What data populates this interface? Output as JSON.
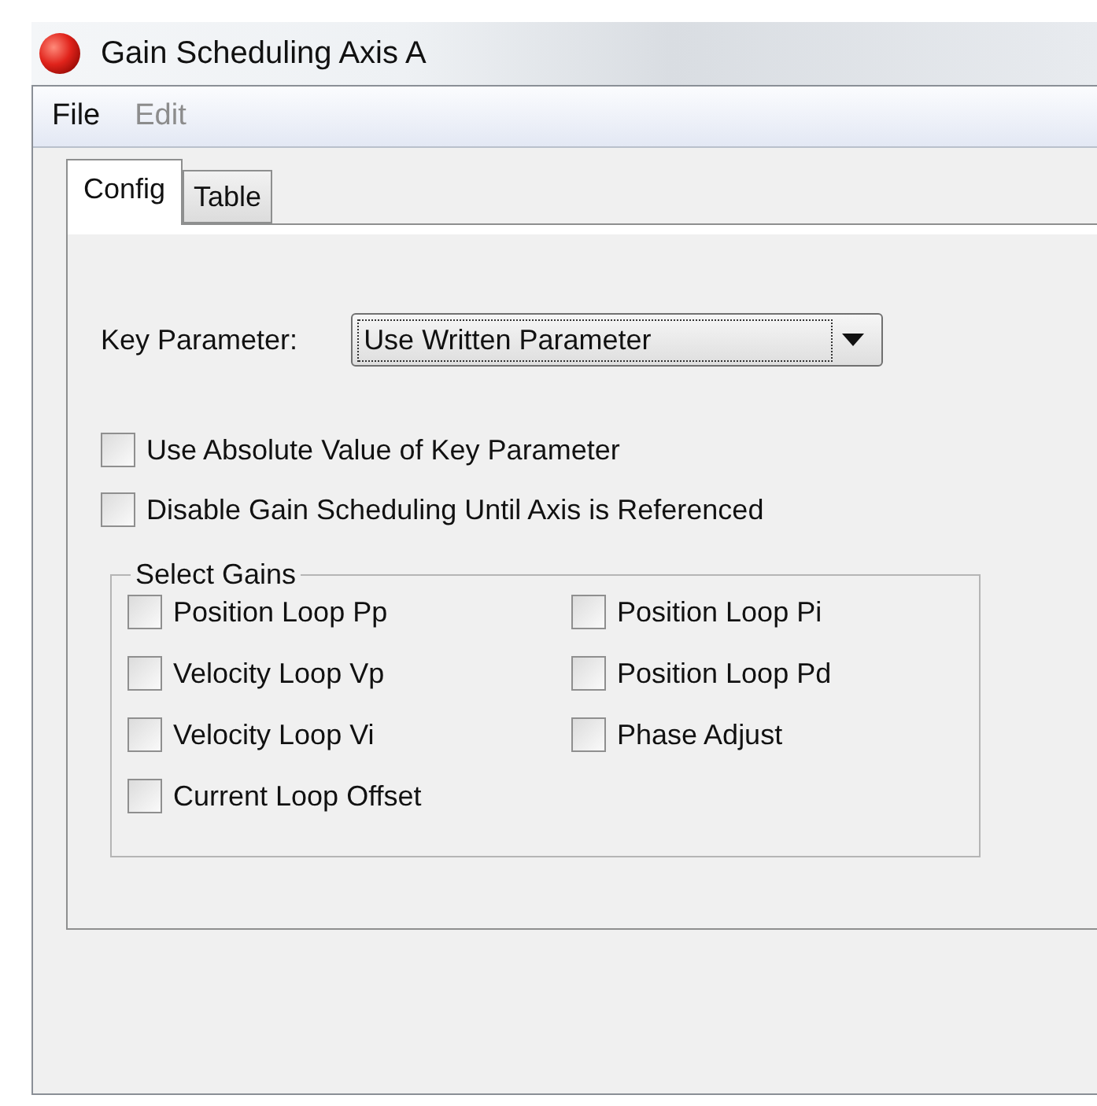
{
  "window": {
    "title": "Gain Scheduling Axis A"
  },
  "menu": [
    {
      "label": "File",
      "disabled": false
    },
    {
      "label": "Edit",
      "disabled": true
    }
  ],
  "tabs": [
    {
      "label": "Config",
      "selected": true
    },
    {
      "label": "Table",
      "selected": false
    }
  ],
  "key_parameter": {
    "label": "Key Parameter:",
    "value": "Use Written Parameter"
  },
  "options": [
    {
      "label": "Use Absolute Value of Key Parameter",
      "checked": false
    },
    {
      "label": "Disable Gain Scheduling Until Axis is Referenced",
      "checked": false
    }
  ],
  "select_gains": {
    "title": "Select Gains",
    "items": [
      {
        "label": "Position Loop Pp",
        "checked": false
      },
      {
        "label": "Position Loop Pi",
        "checked": false
      },
      {
        "label": "Velocity Loop Vp",
        "checked": false
      },
      {
        "label": "Position Loop Pd",
        "checked": false
      },
      {
        "label": "Velocity Loop Vi",
        "checked": false
      },
      {
        "label": "Phase Adjust",
        "checked": false
      },
      {
        "label": "Current Loop Offset",
        "checked": false
      }
    ]
  }
}
